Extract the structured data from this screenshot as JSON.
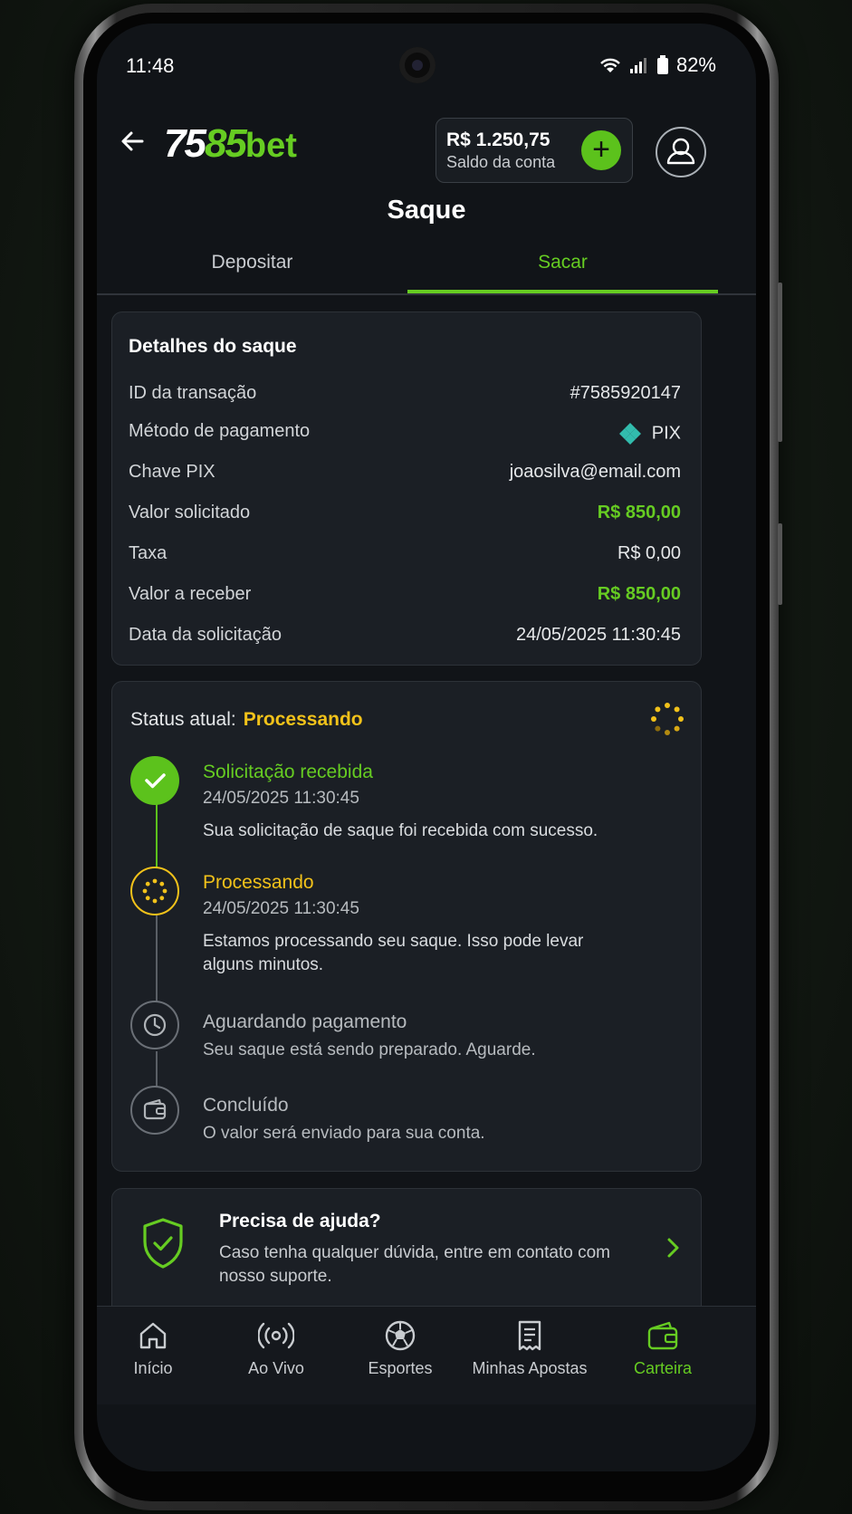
{
  "status_bar": {
    "time": "11:48",
    "battery": "82%"
  },
  "header": {
    "logo_part1": "75",
    "logo_part2": "85",
    "logo_part3": "bet",
    "balance_value": "R$ 1.250,75",
    "balance_label": "Saldo da conta",
    "add_label": "+"
  },
  "page": {
    "title": "Saque"
  },
  "tabs": [
    {
      "label": "Depositar"
    },
    {
      "label": "Sacar"
    }
  ],
  "details": {
    "title": "Detalhes do saque",
    "rows": [
      {
        "label": "ID da transação",
        "value": "#7585920147"
      },
      {
        "label": "Método de pagamento",
        "value": "PIX"
      },
      {
        "label": "Chave PIX",
        "value": "joaosilva@email.com"
      },
      {
        "label": "Valor solicitado",
        "value": "R$ 850,00"
      },
      {
        "label": "Taxa",
        "value": "R$ 0,00"
      },
      {
        "label": "Valor a receber",
        "value": "R$ 850,00"
      },
      {
        "label": "Data da solicitação",
        "value": "24/05/2025 11:30:45"
      }
    ]
  },
  "status": {
    "label": "Status atual:",
    "value": "Processando",
    "steps": [
      {
        "title": "Solicitação recebida",
        "date": "24/05/2025 11:30:45",
        "desc": "Sua solicitação de saque foi recebida com sucesso."
      },
      {
        "title": "Processando",
        "date": "24/05/2025 11:30:45",
        "desc": "Estamos processando seu saque. Isso pode levar alguns minutos."
      },
      {
        "title": "Aguardando pagamento",
        "desc": "Seu saque está sendo preparado. Aguarde."
      },
      {
        "title": "Concluído",
        "desc": "O valor será enviado para sua conta."
      }
    ]
  },
  "help": {
    "title": "Precisa de ajuda?",
    "desc": "Caso tenha qualquer dúvida, entre em contato com nosso suporte."
  },
  "nav": [
    {
      "label": "Início",
      "icon": "home-icon"
    },
    {
      "label": "Ao Vivo",
      "icon": "live-icon"
    },
    {
      "label": "Esportes",
      "icon": "soccer-ball-icon"
    },
    {
      "label": "Minhas Apostas",
      "icon": "receipt-icon"
    },
    {
      "label": "Carteira",
      "icon": "wallet-icon"
    }
  ],
  "colors": {
    "accent": "#66cc22",
    "warning": "#f2c21a",
    "background": "#111418",
    "card": "#1b1f25"
  }
}
